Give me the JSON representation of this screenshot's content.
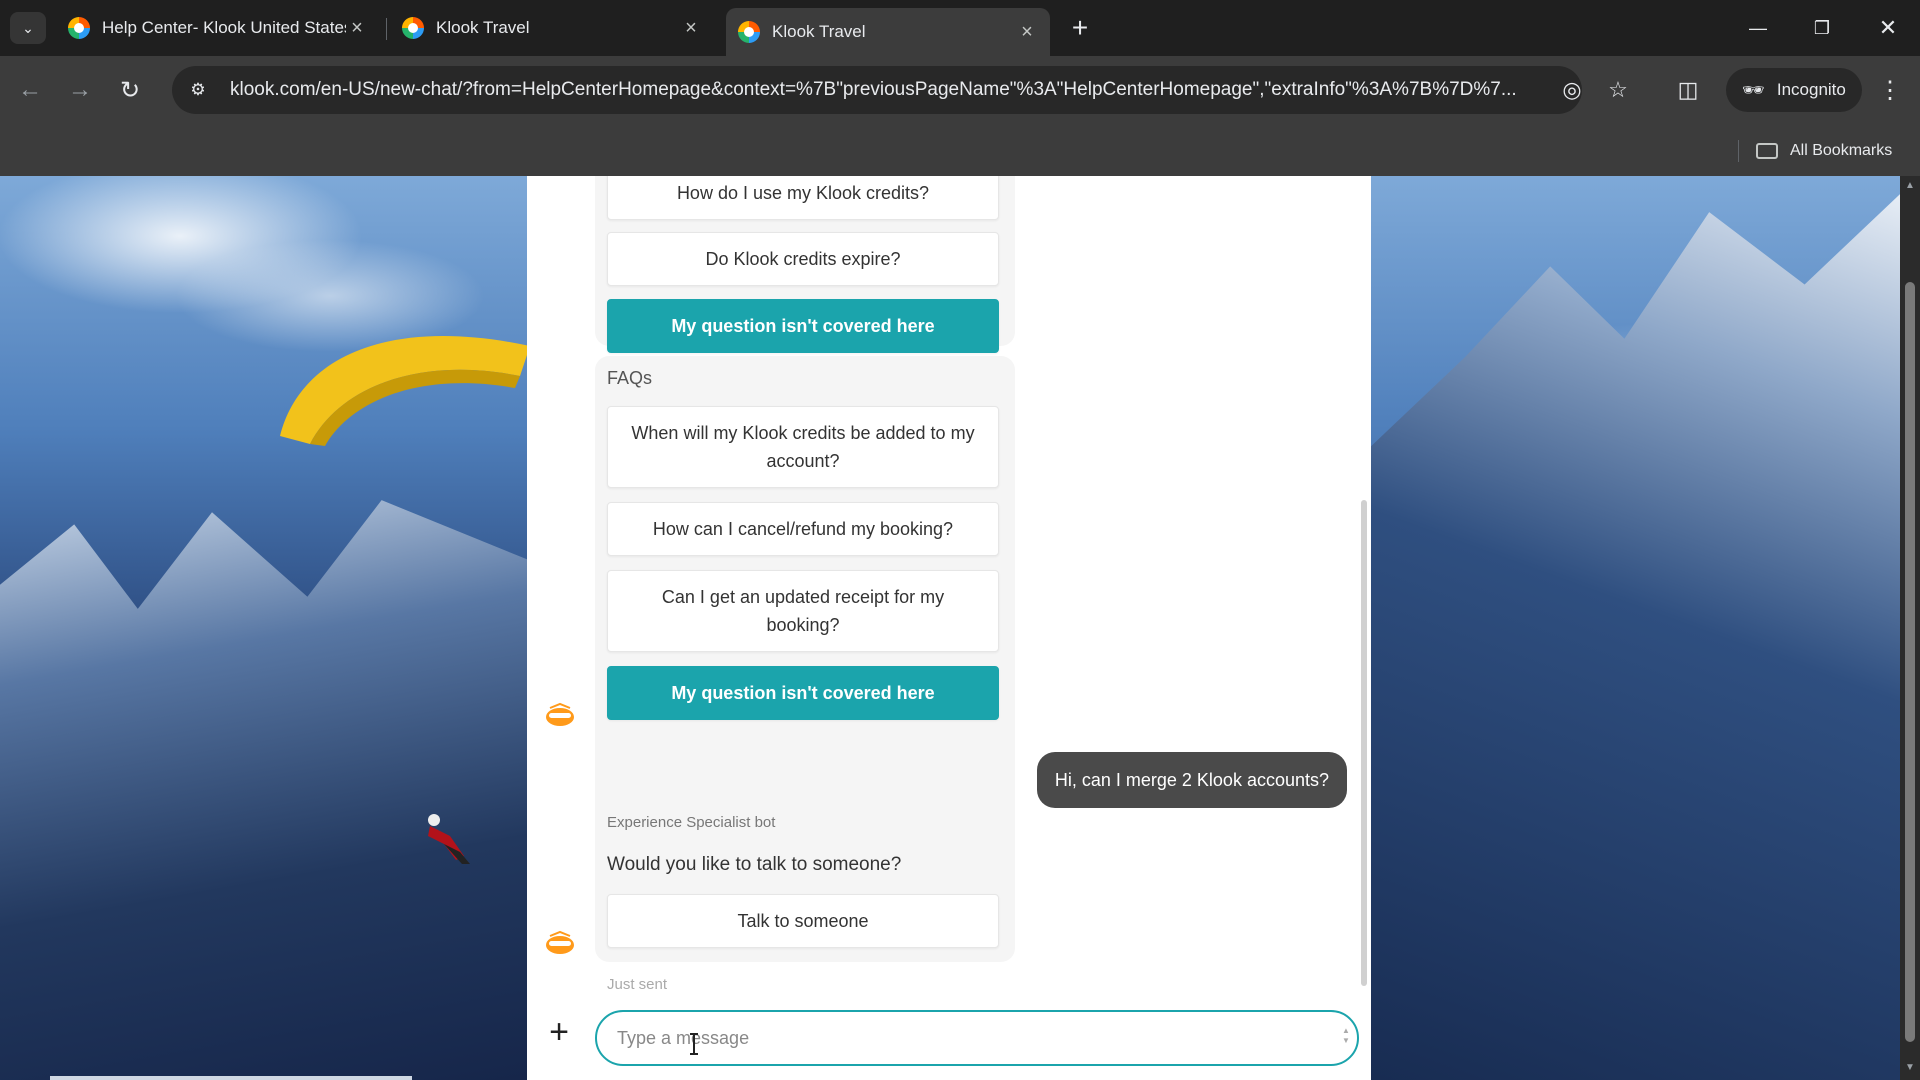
{
  "browser": {
    "tabs": [
      {
        "title": "Help Center- Klook United States",
        "active": false
      },
      {
        "title": "Klook Travel",
        "active": false
      },
      {
        "title": "Klook Travel",
        "active": true
      }
    ],
    "url": "klook.com/en-US/new-chat/?from=HelpCenterHomepage&context=%7B\"previousPageName\"%3A\"HelpCenterHomepage\",\"extraInfo\"%3A%7B%7D%7...",
    "incognito_label": "Incognito",
    "all_bookmarks_label": "All Bookmarks"
  },
  "chat": {
    "group1_options": [
      {
        "label": "How do I use my Klook credits?",
        "style": "default"
      },
      {
        "label": "Do Klook credits expire?",
        "style": "default"
      },
      {
        "label": "My question isn't covered here",
        "style": "primary"
      }
    ],
    "faq_heading": "FAQs",
    "faq_options": [
      {
        "label": "When will my Klook credits be added to my account?",
        "style": "default"
      },
      {
        "label": "How can I cancel/refund my booking?",
        "style": "default"
      },
      {
        "label": "Can I get an updated receipt for my booking?",
        "style": "default"
      },
      {
        "label": "My question isn't covered here",
        "style": "primary"
      }
    ],
    "user_message": "Hi, can I merge 2 Klook accounts?",
    "bot_name": "Experience Specialist bot",
    "bot_message": "Would you like to talk to someone?",
    "talk_option": "Talk to someone",
    "timestamp": "Just sent",
    "composer_placeholder": "Type a message"
  },
  "colors": {
    "accent": "#1ba4ac",
    "user_bubble": "#4a4a4a"
  }
}
